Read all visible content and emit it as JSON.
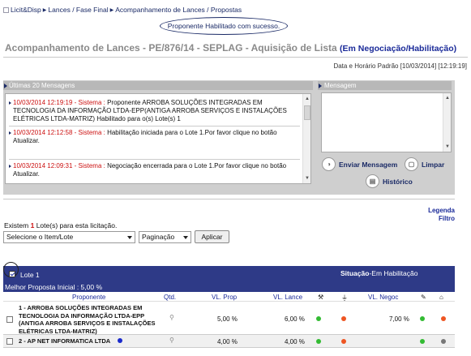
{
  "breadcrumb": {
    "items": [
      "Licit&Disp",
      "Lances / Fase Final",
      "Acompanhamento de Lances / Propostas"
    ]
  },
  "notification": "Proponente Habilitado com sucesso.",
  "header": {
    "title": "Acompanhamento de Lances - PE/876/14 -  SEPLAG - Aquisição de Lista",
    "status": "(Em Negociação/Habilitação)",
    "datetime": "Data e Horário Padrão [10/03/2014] [12:19:19]"
  },
  "messages_panel": {
    "title": "Últimas 20 Mensagens",
    "messages": [
      {
        "timestamp": "10/03/2014 12:19:19 - Sistema :",
        "text": " Proponente ARROBA SOLUÇÕES INTEGRADAS EM TECNOLOGIA DA INFORMAÇÃO LTDA-EPP(ANTIGA ARROBA SERVIÇOS E INSTALAÇÕES ELÉTRICAS LTDA-MATRIZ) Habilitado para o(s) Lote(s) 1"
      },
      {
        "timestamp": "10/03/2014 12:12:58 - Sistema :",
        "text": " Habilitação iniciada para o Lote 1.Por favor clique no botão Atualizar."
      },
      {
        "timestamp": "10/03/2014 12:09:31 - Sistema :",
        "text": " Negociação encerrada para o Lote 1.Por favor clique no botão Atualizar."
      }
    ]
  },
  "compose_panel": {
    "title": "Mensagem",
    "send_label": "Enviar Mensagem",
    "clear_label": "Limpar",
    "history_label": "Histórico"
  },
  "links": {
    "legend": "Legenda",
    "filter": "Filtro"
  },
  "lots": {
    "count_prefix": "Existem ",
    "count": "1",
    "count_suffix": " Lote(s) para esta licitação.",
    "item_select": "Selecione o Item/Lote",
    "pagination_select": "Paginação",
    "apply_label": "Aplicar"
  },
  "lot": {
    "label": "Lote 1",
    "situation_label": "Situação",
    "situation_value": "-Em Habilitação",
    "best_offer": "Melhor Proposta Inicial : 5,00 %"
  },
  "table": {
    "headers": {
      "proponente": "Proponente",
      "qtd": "Qtd.",
      "vl_prop": "VL. Prop",
      "vl_lance": "VL. Lance",
      "vl_negoc": "VL. Negoc"
    },
    "rows": [
      {
        "proponente": [
          "1 - ARROBA SOLUÇÕES INTEGRADAS EM",
          "TECNOLOGIA DA INFORMAÇÃO LTDA-EPP",
          "(ANTIGA ARROBA SERVIÇOS E INSTALAÇÕES",
          "ELÉTRICAS LTDA-MATRIZ)"
        ],
        "vl_prop": "5,00 %",
        "vl_lance": "6,00 %",
        "vl_negoc": "7,00 %"
      },
      {
        "proponente": [
          "2 - AP NET INFORMATICA LTDA"
        ],
        "vl_prop": "4,00 %",
        "vl_lance": "4,00 %",
        "vl_negoc": ""
      }
    ]
  },
  "colors": {
    "brand_blue": "#2e3a87",
    "link_blue": "#1a2a99",
    "timestamp_red": "#cc1111",
    "status_green": "#33bb33",
    "status_orange": "#ee5522"
  }
}
